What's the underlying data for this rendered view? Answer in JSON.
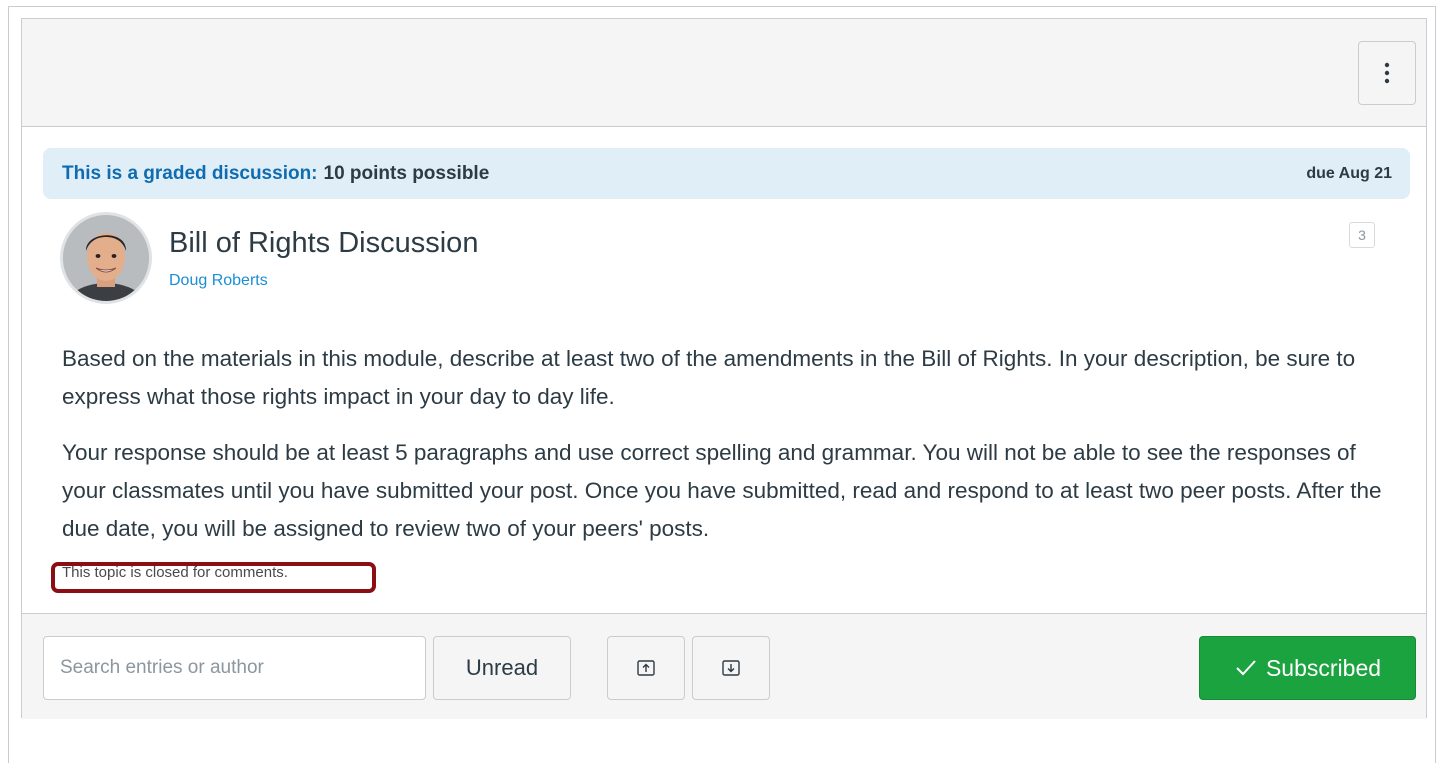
{
  "toolbar": {
    "menu_icon": "kebab-vertical-icon"
  },
  "graded_notice": {
    "label": "This is a graded discussion:",
    "points": "10 points possible",
    "due": "due Aug 21"
  },
  "discussion": {
    "title": "Bill of Rights Discussion",
    "author": "Doug Roberts",
    "count_badge": "3",
    "paragraphs": [
      "Based on the materials in this module, describe at least two of the amendments in the Bill of Rights. In your description, be sure to express what those rights impact in your day to day life.",
      "Your response should be at least 5 paragraphs and use correct spelling and grammar. You will not be able to see the responses of your classmates until you have submitted your post. Once you have submitted, read and respond to at least two peer posts. After the due date, you will be assigned to review two of your peers' posts."
    ],
    "closed_note": "This topic is closed for comments."
  },
  "footer": {
    "search_placeholder": "Search entries or author",
    "unread_label": "Unread",
    "collapse_icon": "arrow-up-icon",
    "expand_icon": "arrow-down-icon",
    "subscribed_label": "Subscribed",
    "subscribed_icon": "checkmark-icon"
  },
  "colors": {
    "graded_bg": "#e0eef7",
    "graded_label": "#0f6cb0",
    "author_link": "#1b8ed4",
    "subscribed_bg": "#1ba340",
    "highlight_border": "#8b0e15"
  }
}
